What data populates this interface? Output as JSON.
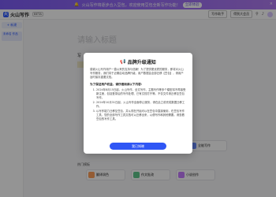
{
  "banner": {
    "text": "火山写作将逐步合入豆包，欢迎使用豆包全新写作功能！",
    "button": "立即体验",
    "close": "×"
  },
  "header": {
    "app_name": "火山写作",
    "badge": "BETA",
    "upgrade_label": "得到大会员",
    "login_label": "写作助手"
  },
  "sidebar": {
    "new_label": "+ 新建",
    "items": [
      {
        "label": "未命名\n作品"
      }
    ]
  },
  "document": {
    "title_placeholder": "请输入标题",
    "first_line": "写"
  },
  "templates": {
    "section_label": "热门模板",
    "cards": [
      {
        "label": "全能写作",
        "color": "#6a8cff"
      },
      {
        "label": "翻译润色",
        "color": "#ff9f5a"
      },
      {
        "label": "作文批改",
        "color": "#5fc78c"
      },
      {
        "label": "小说创作",
        "color": "#c57bff"
      }
    ]
  },
  "modal": {
    "title": "品牌升级通知",
    "intro": "感谢火山写作用户一直以来的支持与信赖！为了提供更优质的服务，即将对火山写作服务，我们将于近期启动品牌升级，用户数据会全部迁移【豆包】，请用户及时保存重要文档。",
    "subtitle": "为了保证用户权益，请仔细阅读以下内容：",
    "items": [
      "2024年8月15日起，火山写作、全文写作、主题写作等多个模型将不再接受新注册，包括登录后的写作处理、已有文档打开等。不仅文件请迁移至豆包写作。",
      "2024年10月31日起，火山写作全面停止服务，请在此之前完成数据迁移工作。",
      "以写作能力迁移至豆包，并从现在开始可以在豆包中直接使用，在豆包写作工具，您的全部写作工具文档可以迁移出来，以便写作和其他需要。请查看豆包的写作工具。"
    ],
    "confirm": "我已知晓"
  }
}
